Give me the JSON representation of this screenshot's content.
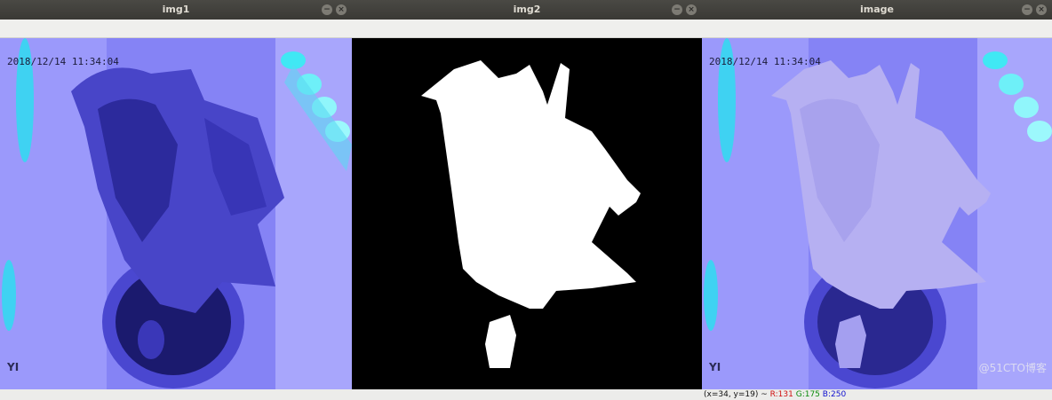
{
  "windows": [
    {
      "title": "img1",
      "timestamp": "2018/12/14  11:34:04",
      "logo": "YI"
    },
    {
      "title": "img2"
    },
    {
      "title": "image",
      "timestamp": "2018/12/14  11:34:04",
      "logo": "YI"
    }
  ],
  "controls": {
    "minimize_icon": "minimize-icon",
    "close_icon": "close-icon",
    "minimize_glyph": "−",
    "close_glyph": "×"
  },
  "status": {
    "coords": "(x=34, y=19) ~ ",
    "r": "R:131",
    "g": "G:175",
    "b": "B:250"
  },
  "watermark": "@51CTO博客",
  "colors": {
    "r": "#d01010",
    "g": "#0a8a0a",
    "b": "#1010d0"
  }
}
